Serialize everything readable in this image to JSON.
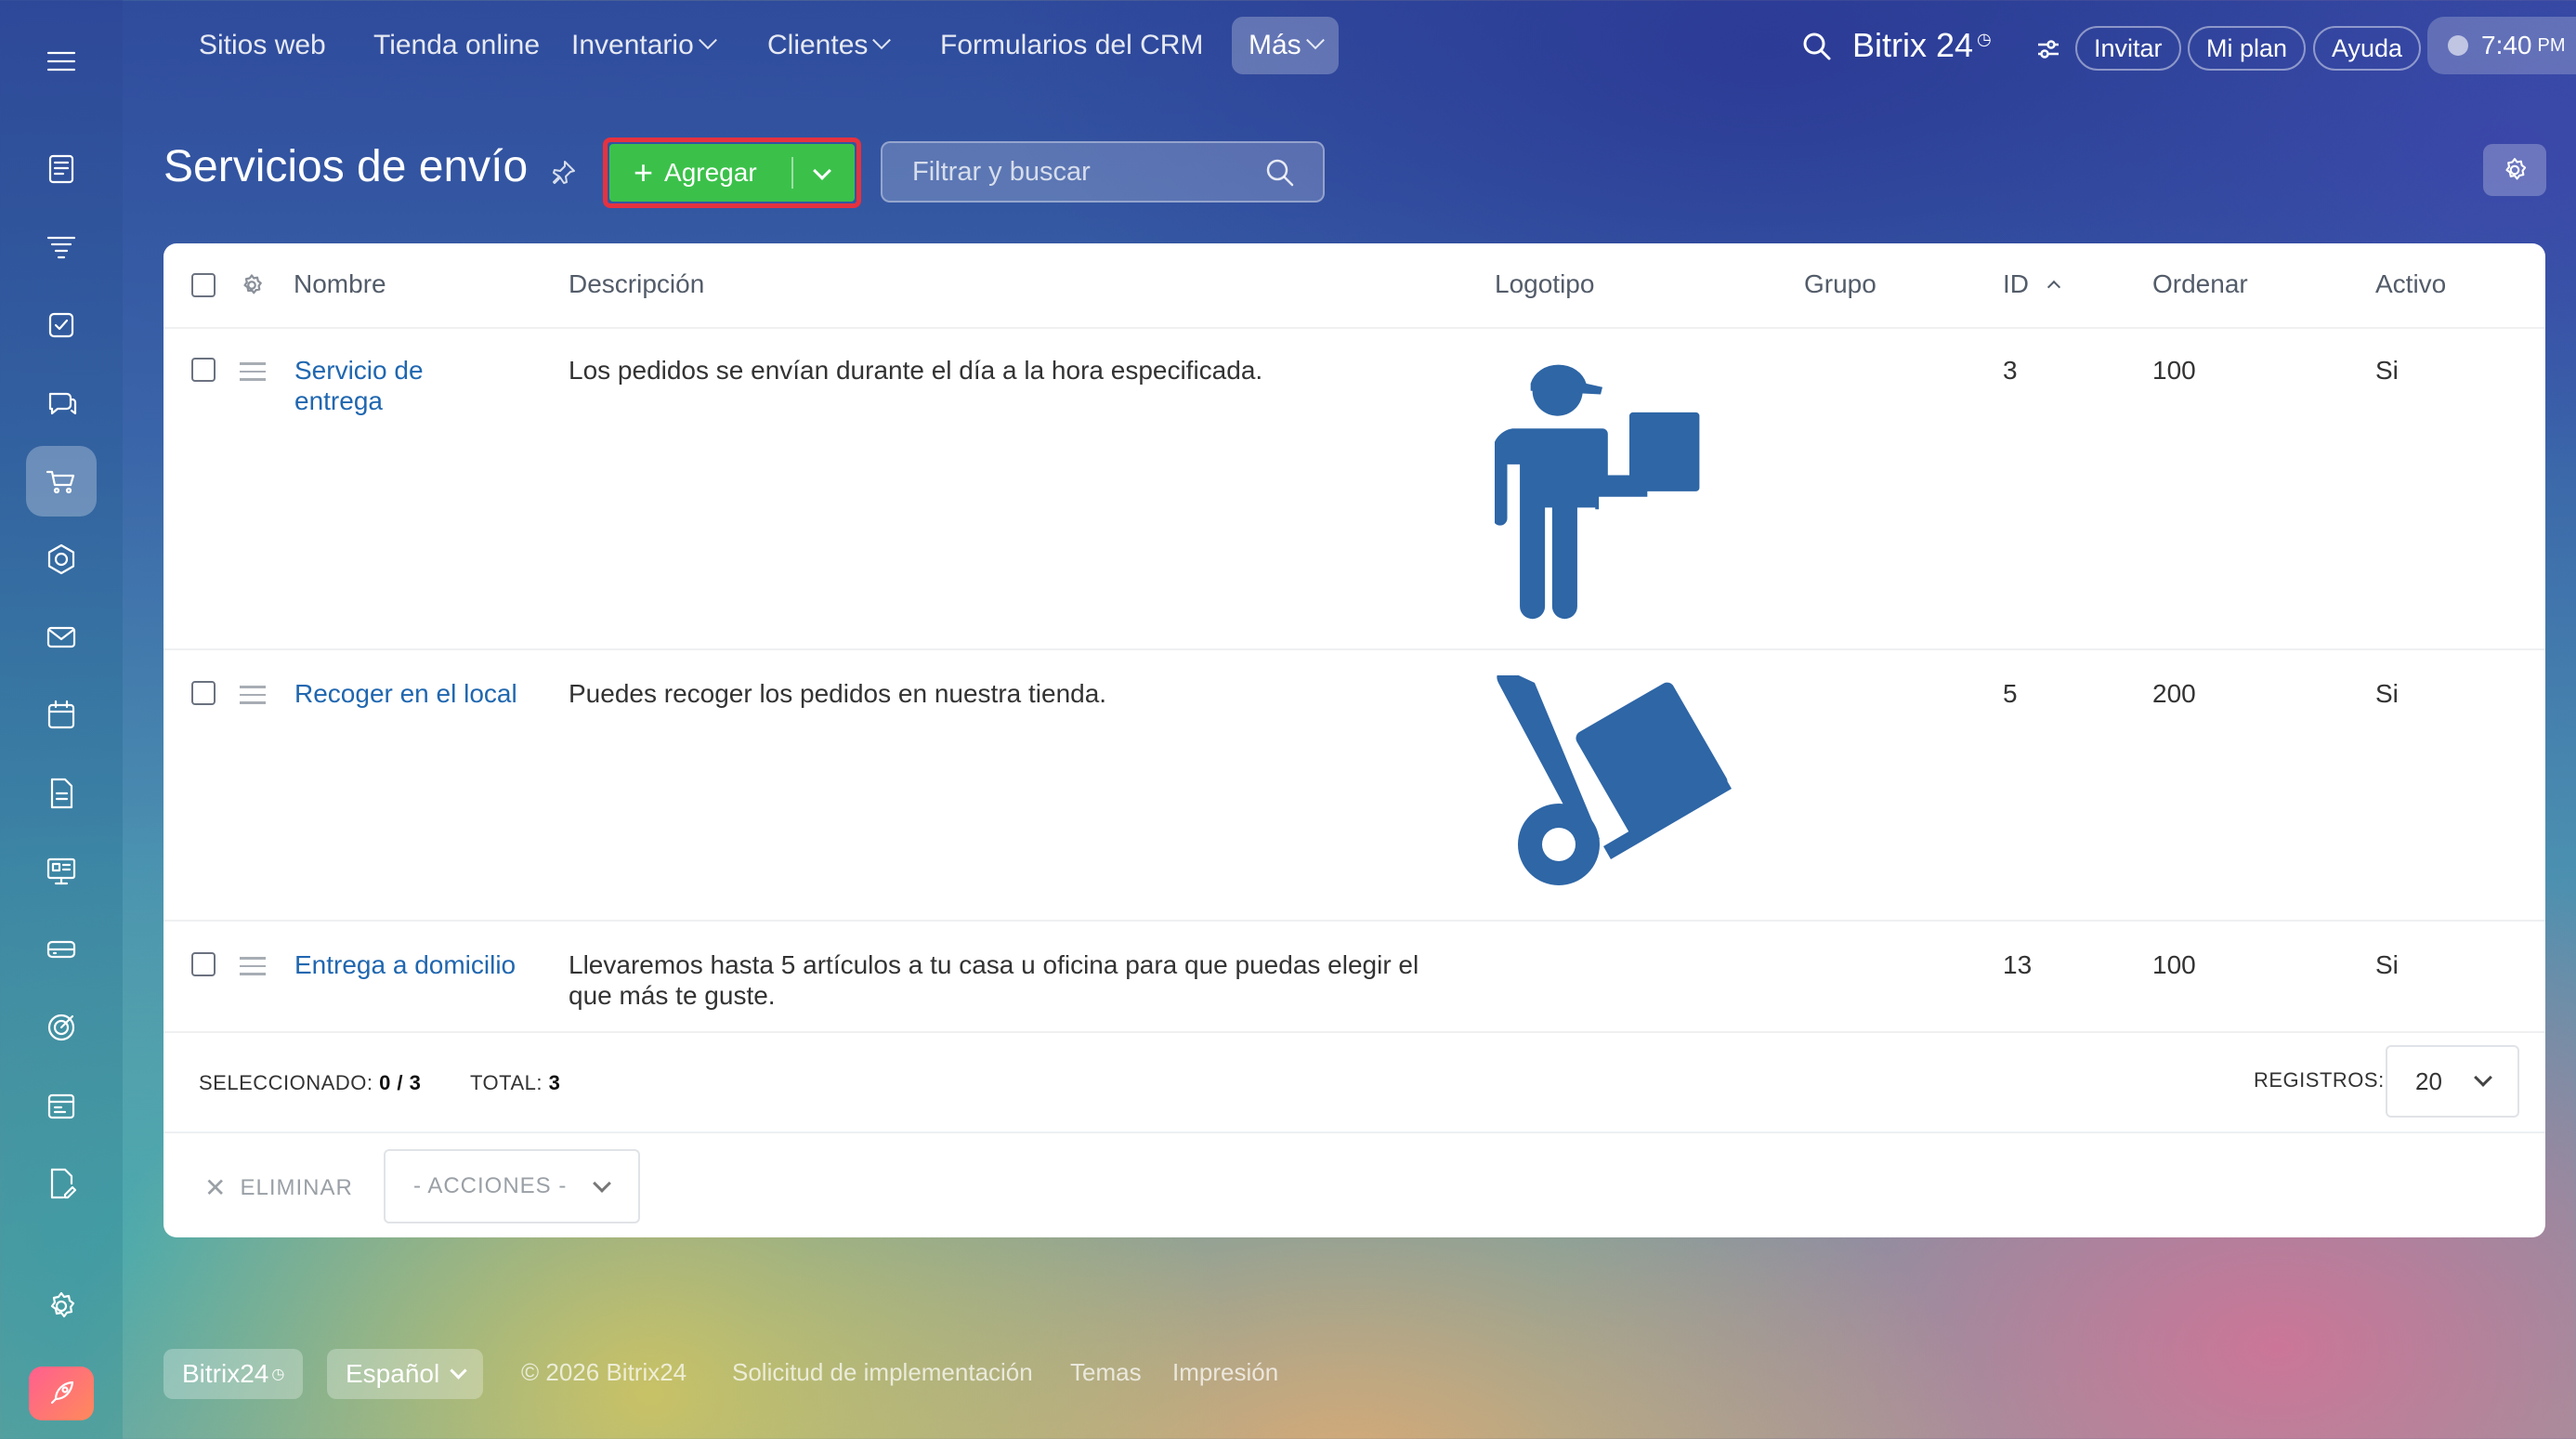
{
  "topnav": {
    "items": [
      {
        "label": "Sitios web"
      },
      {
        "label": "Tienda online"
      },
      {
        "label": "Inventario"
      },
      {
        "label": "Clientes"
      },
      {
        "label": "Formularios del CRM"
      },
      {
        "label": "Más"
      }
    ],
    "brand": "Bitrix 24",
    "invite": "Invitar",
    "plan": "Mi plan",
    "help": "Ayuda",
    "time": "7:40",
    "ampm": "PM"
  },
  "page": {
    "title": "Servicios de envío",
    "add_label": "Agregar",
    "filter_placeholder": "Filtrar y buscar"
  },
  "table": {
    "columns": {
      "name": "Nombre",
      "description": "Descripción",
      "logo": "Logotipo",
      "group": "Grupo",
      "id": "ID",
      "sort": "Ordenar",
      "active": "Activo"
    },
    "rows": [
      {
        "name": "Servicio de entrega",
        "description": "Los pedidos se envían durante el día a la hora especificada.",
        "logo": "delivery-person-icon",
        "group": "",
        "id": "3",
        "sort": "100",
        "active": "Si"
      },
      {
        "name": "Recoger en el local",
        "description": "Puedes recoger los pedidos en nuestra tienda.",
        "logo": "hand-truck-icon",
        "group": "",
        "id": "5",
        "sort": "200",
        "active": "Si"
      },
      {
        "name": "Entrega a domicilio",
        "description": "Llevaremos hasta 5 artículos a tu casa u oficina para que puedas elegir el que más te guste.",
        "logo": "",
        "group": "",
        "id": "13",
        "sort": "100",
        "active": "Si"
      }
    ],
    "footer": {
      "selected_label": "SELECCIONADO:",
      "selected_value": "0 / 3",
      "total_label": "TOTAL:",
      "total_value": "3",
      "records_label": "REGISTROS:",
      "records_value": "20"
    },
    "actions": {
      "delete": "ELIMINAR",
      "actions_placeholder": "- ACCIONES -"
    }
  },
  "bottom": {
    "brand": "Bitrix24",
    "language": "Español",
    "copyright": "© 2026 Bitrix24",
    "implementation": "Solicitud de implementación",
    "themes": "Temas",
    "print": "Impresión"
  },
  "colors": {
    "accent_green": "#3bc14a",
    "highlight_red": "#e5323f",
    "link_blue": "#2067b0",
    "logo_blue": "#2e66a6"
  }
}
